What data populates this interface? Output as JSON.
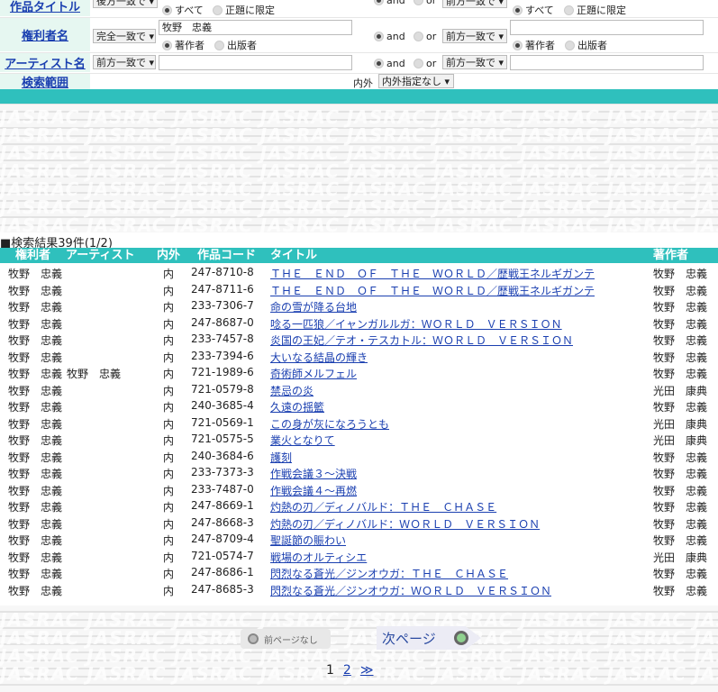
{
  "search_form": {
    "row1": {
      "label": "作品タイトル",
      "match": "後方一致で",
      "scope_all": "すべて",
      "scope_title": "正題に限定",
      "and": "and",
      "or": "or",
      "match2": "前方一致で",
      "scope_all2": "すべて",
      "scope_title2": "正題に限定"
    },
    "row2": {
      "label": "権利者名",
      "match": "完全一致で",
      "value": "牧野　忠義",
      "role_author": "著作者",
      "role_publisher": "出版者",
      "and": "and",
      "or": "or",
      "match2": "前方一致で",
      "role_author2": "著作者",
      "role_publisher2": "出版者"
    },
    "row3": {
      "label": "アーティスト名",
      "match": "前方一致で",
      "and": "and",
      "or": "or",
      "match2": "前方一致で"
    },
    "row4": {
      "label": "検索範囲",
      "inout_label": "内外",
      "inout_value": "内外指定なし"
    }
  },
  "results": {
    "summary": "■検索結果39件(1/2)",
    "headers": {
      "rights": "権利者",
      "artist": "アーティスト",
      "inout": "内外",
      "code": "作品コード",
      "title": "タイトル",
      "author": "著作者"
    },
    "rows": [
      {
        "rights": "牧野　忠義",
        "artist": "",
        "inout": "内",
        "code": "247-8710-8",
        "title": "ＴＨＥ　ＥＮＤ　ＯＦ　ＴＨＥ　ＷＯＲＬＤ／歴戦王ネルギガンテ",
        "author": "牧野　忠義"
      },
      {
        "rights": "牧野　忠義",
        "artist": "",
        "inout": "内",
        "code": "247-8711-6",
        "title": "ＴＨＥ　ＥＮＤ　ＯＦ　ＴＨＥ　ＷＯＲＬＤ／歴戦王ネルギガンテ",
        "author": "牧野　忠義"
      },
      {
        "rights": "牧野　忠義",
        "artist": "",
        "inout": "内",
        "code": "233-7306-7",
        "title": "命の雪が降る台地",
        "author": "牧野　忠義"
      },
      {
        "rights": "牧野　忠義",
        "artist": "",
        "inout": "内",
        "code": "247-8687-0",
        "title": "唸る一匹狼／イャンガルルガ：ＷＯＲＬＤ　ＶＥＲＳＩＯＮ",
        "author": "牧野　忠義"
      },
      {
        "rights": "牧野　忠義",
        "artist": "",
        "inout": "内",
        "code": "233-7457-8",
        "title": "炎国の王妃／テオ・テスカトル：ＷＯＲＬＤ　ＶＥＲＳＩＯＮ",
        "author": "牧野　忠義"
      },
      {
        "rights": "牧野　忠義",
        "artist": "",
        "inout": "内",
        "code": "233-7394-6",
        "title": "大いなる結晶の輝き",
        "author": "牧野　忠義"
      },
      {
        "rights": "牧野　忠義",
        "artist": "牧野　忠義",
        "inout": "内",
        "code": "721-1989-6",
        "title": "奇術師メルフェル",
        "author": "牧野　忠義"
      },
      {
        "rights": "牧野　忠義",
        "artist": "",
        "inout": "内",
        "code": "721-0579-8",
        "title": "禁忌の炎",
        "author": "光田　康典"
      },
      {
        "rights": "牧野　忠義",
        "artist": "",
        "inout": "内",
        "code": "240-3685-4",
        "title": "久遠の揺籃",
        "author": "牧野　忠義"
      },
      {
        "rights": "牧野　忠義",
        "artist": "",
        "inout": "内",
        "code": "721-0569-1",
        "title": "この身が灰になろうとも",
        "author": "光田　康典"
      },
      {
        "rights": "牧野　忠義",
        "artist": "",
        "inout": "内",
        "code": "721-0575-5",
        "title": "業火となりて",
        "author": "光田　康典"
      },
      {
        "rights": "牧野　忠義",
        "artist": "",
        "inout": "内",
        "code": "240-3684-6",
        "title": "護刻",
        "author": "牧野　忠義"
      },
      {
        "rights": "牧野　忠義",
        "artist": "",
        "inout": "内",
        "code": "233-7373-3",
        "title": "作戦会議３～決戦",
        "author": "牧野　忠義"
      },
      {
        "rights": "牧野　忠義",
        "artist": "",
        "inout": "内",
        "code": "233-7487-0",
        "title": "作戦会議４～再燃",
        "author": "牧野　忠義"
      },
      {
        "rights": "牧野　忠義",
        "artist": "",
        "inout": "内",
        "code": "247-8669-1",
        "title": "灼熱の刃／ディノバルド：ＴＨＥ　ＣＨＡＳＥ",
        "author": "牧野　忠義"
      },
      {
        "rights": "牧野　忠義",
        "artist": "",
        "inout": "内",
        "code": "247-8668-3",
        "title": "灼熱の刃／ディノバルド：ＷＯＲＬＤ　ＶＥＲＳＩＯＮ",
        "author": "牧野　忠義"
      },
      {
        "rights": "牧野　忠義",
        "artist": "",
        "inout": "内",
        "code": "247-8709-4",
        "title": "聖誕節の賑わい",
        "author": "牧野　忠義"
      },
      {
        "rights": "牧野　忠義",
        "artist": "",
        "inout": "内",
        "code": "721-0574-7",
        "title": "戦場のオルティシエ",
        "author": "光田　康典"
      },
      {
        "rights": "牧野　忠義",
        "artist": "",
        "inout": "内",
        "code": "247-8686-1",
        "title": "閃烈なる蒼光／ジンオウガ：ＴＨＥ　ＣＨＡＳＥ",
        "author": "牧野　忠義"
      },
      {
        "rights": "牧野　忠義",
        "artist": "",
        "inout": "内",
        "code": "247-8685-3",
        "title": "閃烈なる蒼光／ジンオウガ：ＷＯＲＬＤ　ＶＥＲＳＩＯＮ",
        "author": "牧野　忠義"
      }
    ]
  },
  "pager": {
    "prev_label": "前ページなし",
    "next_label": "次ページ",
    "page1": "1",
    "page2": "2",
    "last": "≫"
  },
  "watermark": "JASRAC"
}
